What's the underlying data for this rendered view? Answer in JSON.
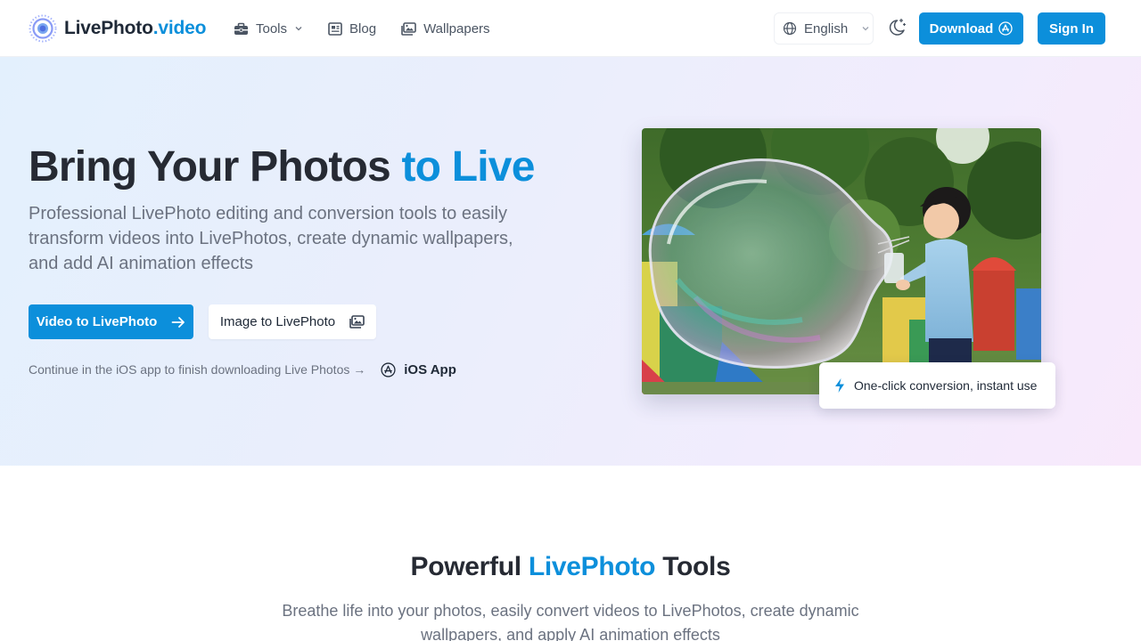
{
  "header": {
    "logo": {
      "name": "LivePhoto",
      "accent": ".video"
    },
    "nav": [
      {
        "label": "Tools",
        "icon": "toolbox-icon",
        "has_dropdown": true
      },
      {
        "label": "Blog",
        "icon": "newspaper-icon"
      },
      {
        "label": "Wallpapers",
        "icon": "images-icon"
      }
    ],
    "language": {
      "selected": "English",
      "icon": "globe-icon"
    },
    "theme_toggle_icon": "moon-stars-icon",
    "download_label": "Download",
    "signin_label": "Sign In"
  },
  "hero": {
    "title_main": "Bring Your Photos ",
    "title_accent": "to Live",
    "subtitle": "Professional LivePhoto editing and conversion tools to easily transform videos into LivePhotos, create dynamic wallpapers, and add AI animation effects",
    "primary_button": "Video to LivePhoto",
    "secondary_button": "Image to LivePhoto",
    "ios_note": "Continue in the iOS app to finish downloading Live Photos →",
    "ios_link": "iOS App",
    "badge": "One-click conversion, instant use"
  },
  "tools_section": {
    "title_before": "Powerful ",
    "title_accent": "LivePhoto",
    "title_after": " Tools",
    "subtitle": "Breathe life into your photos, easily convert videos to LivePhotos, create dynamic wallpapers, and apply AI animation effects"
  },
  "colors": {
    "accent": "#0c8fdb",
    "text_dark": "#262a33",
    "text_muted": "#6b7280"
  }
}
